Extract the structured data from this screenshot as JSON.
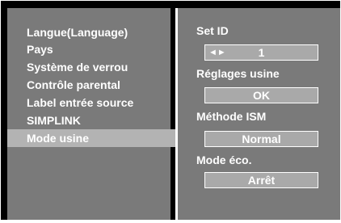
{
  "menu": {
    "items": [
      {
        "label": "Langue(Language)"
      },
      {
        "label": "Pays"
      },
      {
        "label": "Système de verrou"
      },
      {
        "label": "Contrôle parental"
      },
      {
        "label": "Label entrée source"
      },
      {
        "label": "SIMPLINK"
      },
      {
        "label": "Mode usine"
      }
    ],
    "selected": "Mode usine"
  },
  "options": {
    "set_id": {
      "title": "Set ID",
      "value": "1",
      "arrows": "◄►"
    },
    "factory_reset": {
      "title": "Réglages usine",
      "value": "OK"
    },
    "ism_method": {
      "title": "Méthode ISM",
      "value": "Normal"
    },
    "eco_mode": {
      "title": "Mode éco.",
      "value": "Arrêt"
    }
  },
  "colors": {
    "background": "#000000",
    "pane": "#7a7a7a",
    "selection": "#b3b3b3",
    "value_box": "#a9a9a9",
    "text": "#ffffff"
  }
}
